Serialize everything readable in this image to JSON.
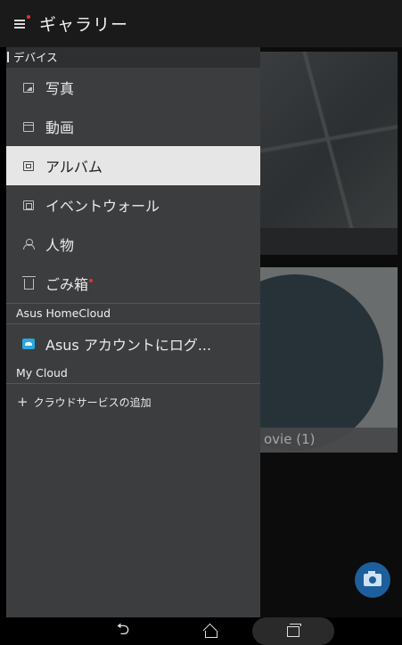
{
  "app_bar": {
    "title": "ギャラリー",
    "menu_icon": "menu-icon"
  },
  "background": {
    "thumb2_caption": "ovie (1)"
  },
  "drawer": {
    "section_device": "デバイス",
    "items": [
      {
        "label": "写真",
        "icon": "photo-icon"
      },
      {
        "label": "動画",
        "icon": "video-icon"
      },
      {
        "label": "アルバム",
        "icon": "album-icon",
        "active": true
      },
      {
        "label": "イベントウォール",
        "icon": "event-wall-icon"
      },
      {
        "label": "人物",
        "icon": "person-icon"
      },
      {
        "label": "ごみ箱",
        "icon": "trash-icon"
      }
    ],
    "section_homecloud": "Asus HomeCloud",
    "homecloud_item": "Asus アカウントにログ...",
    "section_mycloud": "My Cloud",
    "add_service": "クラウドサービスの追加"
  },
  "colors": {
    "accent_red": "#e8312f",
    "drawer_bg": "#3c3d3f",
    "active_bg": "#e6e6e6",
    "fab_blue": "#1d5f9c"
  }
}
